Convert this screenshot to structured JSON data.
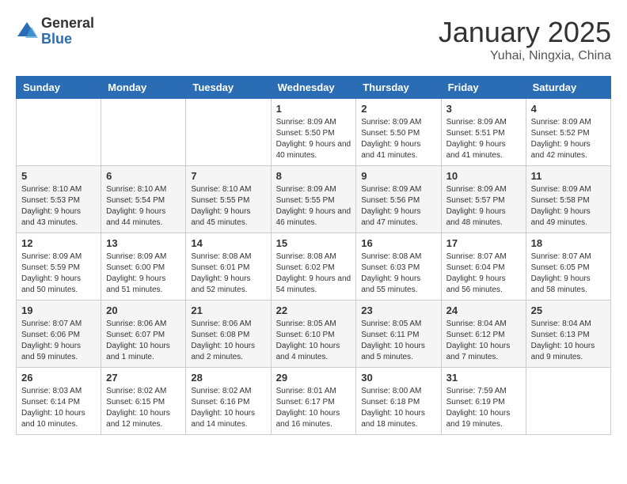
{
  "header": {
    "logo_general": "General",
    "logo_blue": "Blue",
    "month_title": "January 2025",
    "location": "Yuhai, Ningxia, China"
  },
  "calendar": {
    "days_of_week": [
      "Sunday",
      "Monday",
      "Tuesday",
      "Wednesday",
      "Thursday",
      "Friday",
      "Saturday"
    ],
    "weeks": [
      [
        {
          "day": "",
          "info": ""
        },
        {
          "day": "",
          "info": ""
        },
        {
          "day": "",
          "info": ""
        },
        {
          "day": "1",
          "info": "Sunrise: 8:09 AM\nSunset: 5:50 PM\nDaylight: 9 hours\nand 40 minutes."
        },
        {
          "day": "2",
          "info": "Sunrise: 8:09 AM\nSunset: 5:50 PM\nDaylight: 9 hours\nand 41 minutes."
        },
        {
          "day": "3",
          "info": "Sunrise: 8:09 AM\nSunset: 5:51 PM\nDaylight: 9 hours\nand 41 minutes."
        },
        {
          "day": "4",
          "info": "Sunrise: 8:09 AM\nSunset: 5:52 PM\nDaylight: 9 hours\nand 42 minutes."
        }
      ],
      [
        {
          "day": "5",
          "info": "Sunrise: 8:10 AM\nSunset: 5:53 PM\nDaylight: 9 hours\nand 43 minutes."
        },
        {
          "day": "6",
          "info": "Sunrise: 8:10 AM\nSunset: 5:54 PM\nDaylight: 9 hours\nand 44 minutes."
        },
        {
          "day": "7",
          "info": "Sunrise: 8:10 AM\nSunset: 5:55 PM\nDaylight: 9 hours\nand 45 minutes."
        },
        {
          "day": "8",
          "info": "Sunrise: 8:09 AM\nSunset: 5:55 PM\nDaylight: 9 hours\nand 46 minutes."
        },
        {
          "day": "9",
          "info": "Sunrise: 8:09 AM\nSunset: 5:56 PM\nDaylight: 9 hours\nand 47 minutes."
        },
        {
          "day": "10",
          "info": "Sunrise: 8:09 AM\nSunset: 5:57 PM\nDaylight: 9 hours\nand 48 minutes."
        },
        {
          "day": "11",
          "info": "Sunrise: 8:09 AM\nSunset: 5:58 PM\nDaylight: 9 hours\nand 49 minutes."
        }
      ],
      [
        {
          "day": "12",
          "info": "Sunrise: 8:09 AM\nSunset: 5:59 PM\nDaylight: 9 hours\nand 50 minutes."
        },
        {
          "day": "13",
          "info": "Sunrise: 8:09 AM\nSunset: 6:00 PM\nDaylight: 9 hours\nand 51 minutes."
        },
        {
          "day": "14",
          "info": "Sunrise: 8:08 AM\nSunset: 6:01 PM\nDaylight: 9 hours\nand 52 minutes."
        },
        {
          "day": "15",
          "info": "Sunrise: 8:08 AM\nSunset: 6:02 PM\nDaylight: 9 hours\nand 54 minutes."
        },
        {
          "day": "16",
          "info": "Sunrise: 8:08 AM\nSunset: 6:03 PM\nDaylight: 9 hours\nand 55 minutes."
        },
        {
          "day": "17",
          "info": "Sunrise: 8:07 AM\nSunset: 6:04 PM\nDaylight: 9 hours\nand 56 minutes."
        },
        {
          "day": "18",
          "info": "Sunrise: 8:07 AM\nSunset: 6:05 PM\nDaylight: 9 hours\nand 58 minutes."
        }
      ],
      [
        {
          "day": "19",
          "info": "Sunrise: 8:07 AM\nSunset: 6:06 PM\nDaylight: 9 hours\nand 59 minutes."
        },
        {
          "day": "20",
          "info": "Sunrise: 8:06 AM\nSunset: 6:07 PM\nDaylight: 10 hours\nand 1 minute."
        },
        {
          "day": "21",
          "info": "Sunrise: 8:06 AM\nSunset: 6:08 PM\nDaylight: 10 hours\nand 2 minutes."
        },
        {
          "day": "22",
          "info": "Sunrise: 8:05 AM\nSunset: 6:10 PM\nDaylight: 10 hours\nand 4 minutes."
        },
        {
          "day": "23",
          "info": "Sunrise: 8:05 AM\nSunset: 6:11 PM\nDaylight: 10 hours\nand 5 minutes."
        },
        {
          "day": "24",
          "info": "Sunrise: 8:04 AM\nSunset: 6:12 PM\nDaylight: 10 hours\nand 7 minutes."
        },
        {
          "day": "25",
          "info": "Sunrise: 8:04 AM\nSunset: 6:13 PM\nDaylight: 10 hours\nand 9 minutes."
        }
      ],
      [
        {
          "day": "26",
          "info": "Sunrise: 8:03 AM\nSunset: 6:14 PM\nDaylight: 10 hours\nand 10 minutes."
        },
        {
          "day": "27",
          "info": "Sunrise: 8:02 AM\nSunset: 6:15 PM\nDaylight: 10 hours\nand 12 minutes."
        },
        {
          "day": "28",
          "info": "Sunrise: 8:02 AM\nSunset: 6:16 PM\nDaylight: 10 hours\nand 14 minutes."
        },
        {
          "day": "29",
          "info": "Sunrise: 8:01 AM\nSunset: 6:17 PM\nDaylight: 10 hours\nand 16 minutes."
        },
        {
          "day": "30",
          "info": "Sunrise: 8:00 AM\nSunset: 6:18 PM\nDaylight: 10 hours\nand 18 minutes."
        },
        {
          "day": "31",
          "info": "Sunrise: 7:59 AM\nSunset: 6:19 PM\nDaylight: 10 hours\nand 19 minutes."
        },
        {
          "day": "",
          "info": ""
        }
      ]
    ]
  }
}
